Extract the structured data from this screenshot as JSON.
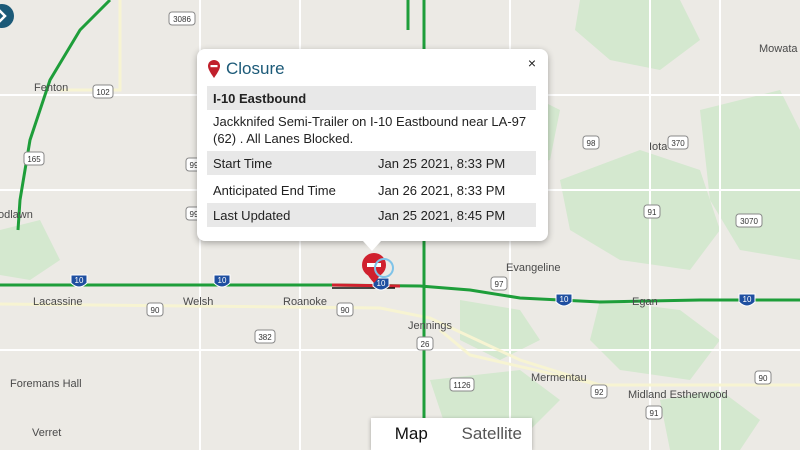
{
  "popup": {
    "title": "Closure",
    "close_symbol": "×",
    "heading": "I-10 Eastbound",
    "description": "Jackknifed Semi-Trailer on I-10 Eastbound near LA-97 (62) . All Lanes Blocked.",
    "rows": [
      {
        "label": "Start Time",
        "value": "Jan 25 2021, 8:33 PM"
      },
      {
        "label": "Anticipated End Time",
        "value": "Jan 26 2021, 8:33 PM"
      },
      {
        "label": "Last Updated",
        "value": "Jan 25 2021, 8:45 PM"
      }
    ]
  },
  "map_type": {
    "map_label": "Map",
    "satellite_label": "Satellite",
    "selected": "Map"
  },
  "places": {
    "fenton": "Fenton",
    "odlawn": "odlawn",
    "lacassine": "Lacassine",
    "welsh": "Welsh",
    "roanoke": "Roanoke",
    "jennings": "Jennings",
    "evangeline": "Evangeline",
    "egan": "Egan",
    "iota": "Iota",
    "mowata": "Mowata",
    "foremans_hall": "Foremans Hall",
    "mermentau": "Mermentau",
    "midland_estherwood": "Midland Estherwood",
    "verret": "Verret"
  },
  "shields": {
    "r3086": "3086",
    "r102": "102",
    "r165": "165",
    "r99a": "99",
    "r99b": "99",
    "r98": "98",
    "r370": "370",
    "r91a": "91",
    "r91b": "91",
    "r3070": "3070",
    "r97": "97",
    "r90a": "90",
    "r90b": "90",
    "r90c": "90",
    "r382": "382",
    "r26": "26",
    "r1126": "1126",
    "r92": "92",
    "i10a": "10",
    "i10b": "10",
    "i10c": "10",
    "i10d": "10",
    "i10e": "10"
  },
  "colors": {
    "highway_green": "#1e9e3a",
    "closure_red": "#d0212e",
    "popup_title": "#1c5a78",
    "land": "#eceae5",
    "park": "#d4e8cf"
  },
  "icons": {
    "closure_marker": "closure-pin-icon",
    "close": "close-icon",
    "nav": "chevron-right-icon"
  }
}
